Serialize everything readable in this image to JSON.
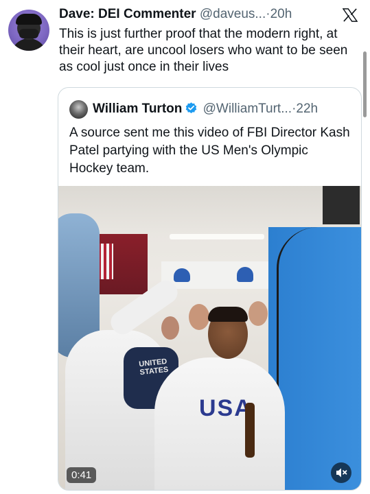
{
  "tweet": {
    "author_name": "Dave: DEI Commenter",
    "author_handle": "@daveus...",
    "separator": "·",
    "time": "20h",
    "text": "This is just further proof that the modern right, at their heart, are uncool losers who want to be seen as cool just once in their lives",
    "platform_icon": "x-logo-icon",
    "avatar_icon": "avatar"
  },
  "quoted_tweet": {
    "author_name": "William Turton",
    "verified_icon": "verified-badge-icon",
    "verified_color": "#1d9bf0",
    "author_handle": "@WilliamTurt...",
    "separator": "·",
    "time": "22h",
    "text": "A source sent me this video of FBI Director Kash Patel partying with the US Men's Olympic Hockey team.",
    "video": {
      "timestamp": "0:41",
      "mute_icon": "speaker-muted-icon"
    }
  }
}
